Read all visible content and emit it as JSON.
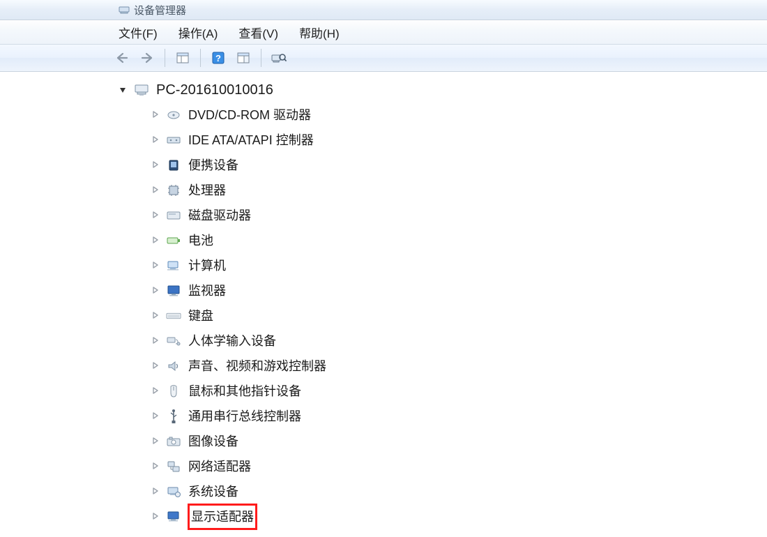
{
  "title": "设备管理器",
  "menus": {
    "file": "文件(F)",
    "action": "操作(A)",
    "view": "查看(V)",
    "help": "帮助(H)"
  },
  "toolbar": {
    "back_icon": "back-arrow-icon",
    "forward_icon": "forward-arrow-icon",
    "props_icon": "properties-pane-icon",
    "help_icon": "help-icon",
    "pane_icon": "detail-pane-icon",
    "scan_icon": "scan-hardware-icon"
  },
  "tree": {
    "root": {
      "label": "PC-201610010016",
      "expanded": true,
      "icon": "computer-icon"
    },
    "children": [
      {
        "label": "DVD/CD-ROM 驱动器",
        "icon": "optical-drive-icon"
      },
      {
        "label": "IDE ATA/ATAPI 控制器",
        "icon": "ide-controller-icon"
      },
      {
        "label": "便携设备",
        "icon": "portable-device-icon"
      },
      {
        "label": "处理器",
        "icon": "processor-icon"
      },
      {
        "label": "磁盘驱动器",
        "icon": "disk-drive-icon"
      },
      {
        "label": "电池",
        "icon": "battery-icon"
      },
      {
        "label": "计算机",
        "icon": "computer-category-icon"
      },
      {
        "label": "监视器",
        "icon": "monitor-icon"
      },
      {
        "label": "键盘",
        "icon": "keyboard-icon"
      },
      {
        "label": "人体学输入设备",
        "icon": "hid-icon"
      },
      {
        "label": "声音、视频和游戏控制器",
        "icon": "sound-icon"
      },
      {
        "label": "鼠标和其他指针设备",
        "icon": "mouse-icon"
      },
      {
        "label": "通用串行总线控制器",
        "icon": "usb-icon"
      },
      {
        "label": "图像设备",
        "icon": "imaging-icon"
      },
      {
        "label": "网络适配器",
        "icon": "network-icon"
      },
      {
        "label": "系统设备",
        "icon": "system-device-icon"
      },
      {
        "label": "显示适配器",
        "icon": "display-adapter-icon",
        "highlight": true
      }
    ]
  }
}
